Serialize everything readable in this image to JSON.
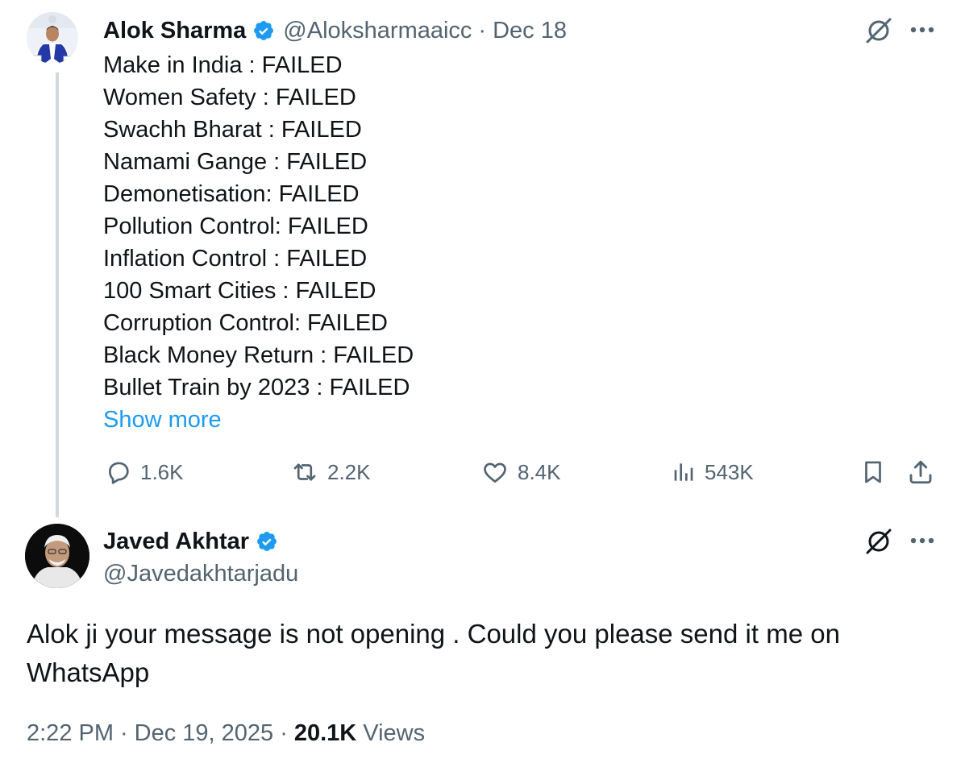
{
  "parent_tweet": {
    "author_name": "Alok Sharma",
    "handle": "@Aloksharmaaicc",
    "separator": "·",
    "date": "Dec 18",
    "lines": [
      "Make in India : FAILED",
      "Women Safety : FAILED",
      "Swachh Bharat : FAILED",
      "Namami Gange : FAILED",
      "Demonetisation: FAILED",
      "Pollution Control: FAILED",
      "Inflation Control : FAILED",
      "100 Smart Cities : FAILED",
      "Corruption Control: FAILED",
      "Black Money Return : FAILED",
      "Bullet Train by 2023 : FAILED"
    ],
    "show_more_label": "Show more",
    "actions": {
      "replies": "1.6K",
      "reposts": "2.2K",
      "likes": "8.4K",
      "views": "543K"
    },
    "icons": [
      "verified-badge-icon",
      "grok-icon",
      "more-icon",
      "reply-icon",
      "repost-icon",
      "like-icon",
      "views-icon",
      "bookmark-icon",
      "share-icon"
    ]
  },
  "reply_tweet": {
    "author_name": "Javed Akhtar",
    "handle": "@Javedakhtarjadu",
    "text": "Alok ji your message is not opening . Could you please send it me on WhatsApp",
    "time": "2:22 PM",
    "separator": "·",
    "date": "Dec 19, 2025",
    "views_count": "20.1K",
    "views_label": "Views",
    "icons": [
      "verified-badge-icon",
      "grok-icon",
      "more-icon"
    ]
  },
  "colors": {
    "primary_text": "#0f1419",
    "secondary_text": "#536471",
    "link_blue": "#1d9bf0",
    "thread_line": "#cfd9de"
  }
}
